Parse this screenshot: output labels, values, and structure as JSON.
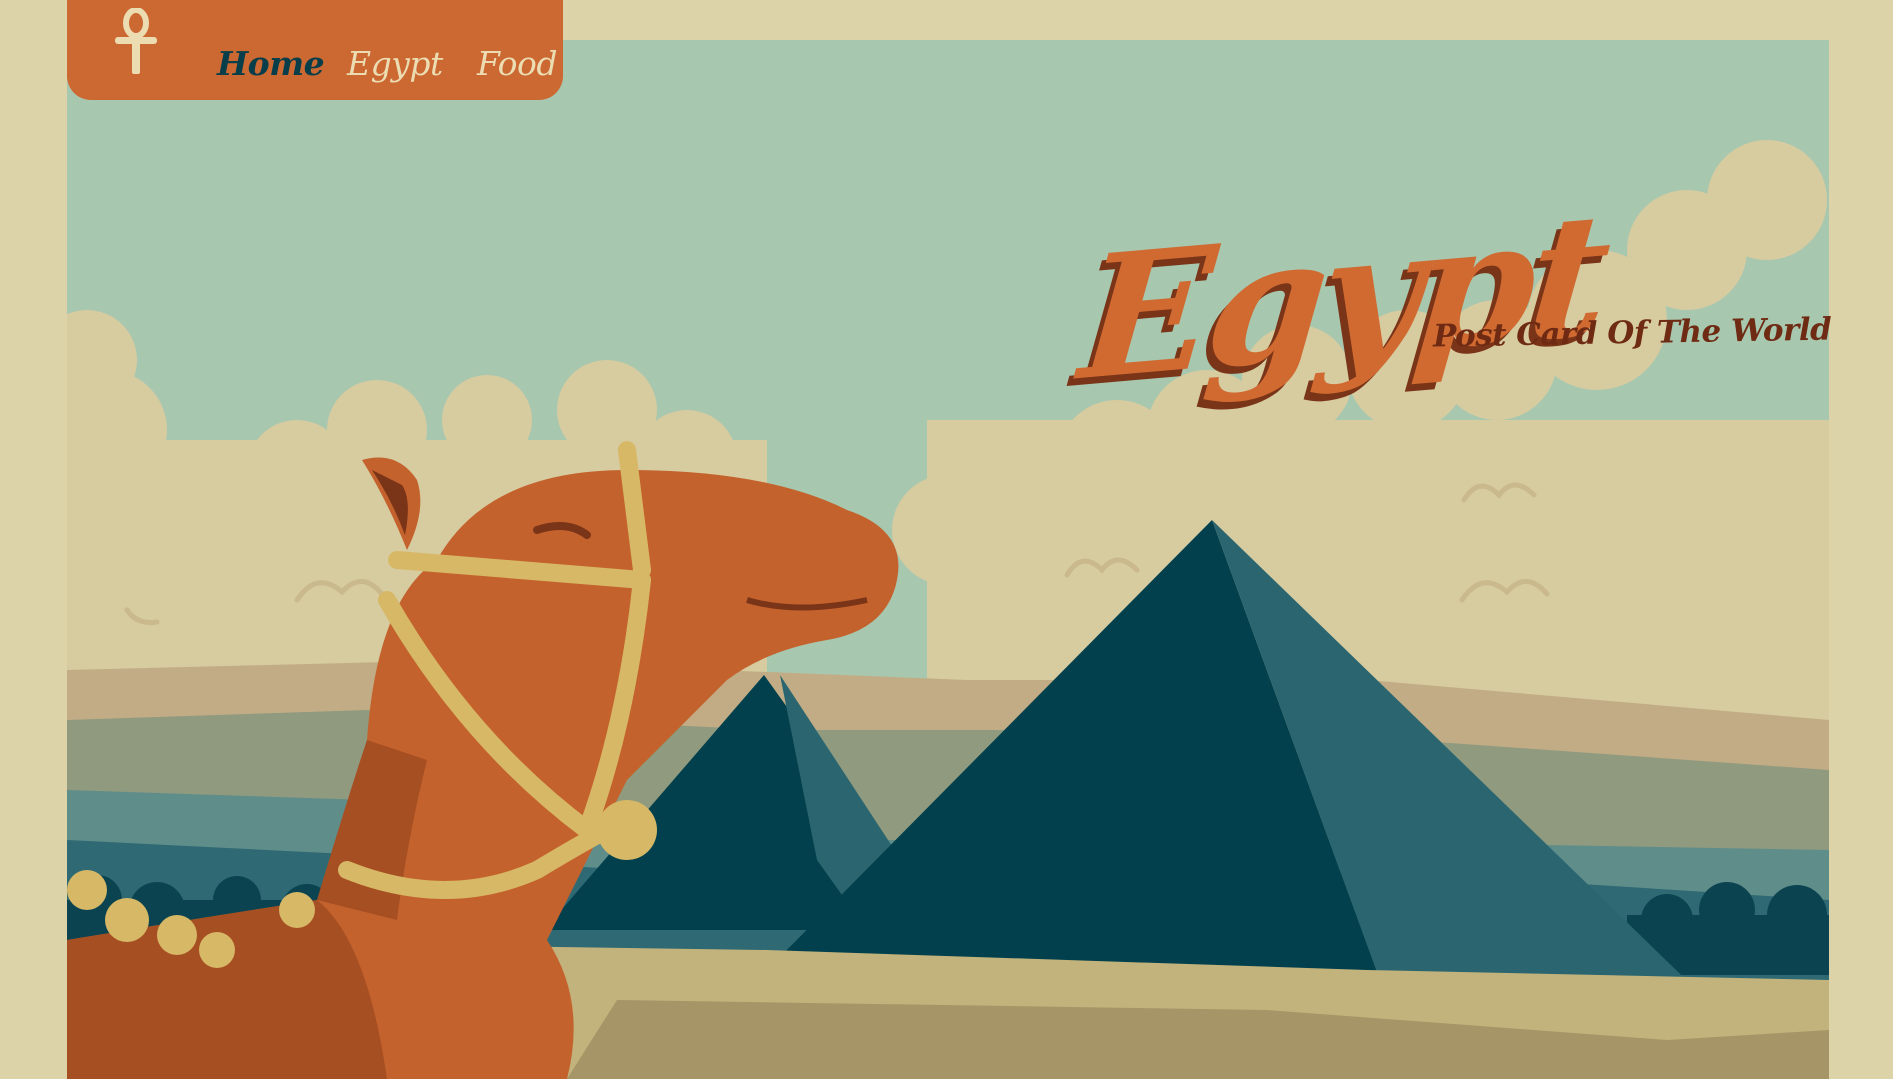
{
  "nav": {
    "links": [
      {
        "label": "Home",
        "active": true
      },
      {
        "label": "Egypt",
        "active": false
      },
      {
        "label": "Food",
        "active": false
      }
    ]
  },
  "hero": {
    "title": "Egypt",
    "subtitle": "Post Card Of The World"
  },
  "colors": {
    "page_background": "#dcd3a8",
    "sky": "#a8c7af",
    "nav_background": "#cc6831",
    "nav_active_text": "#073e4a",
    "nav_text": "#ecdcb2",
    "title": "#d06a31",
    "title_shadow": "#7a3418",
    "subtitle": "#6e2a12",
    "pyramid_dark": "#03404d",
    "pyramid_light": "#2b6670",
    "camel": "#c4622d",
    "sand": "#c2b27c"
  },
  "icons": {
    "logo": "ankh-icon"
  }
}
